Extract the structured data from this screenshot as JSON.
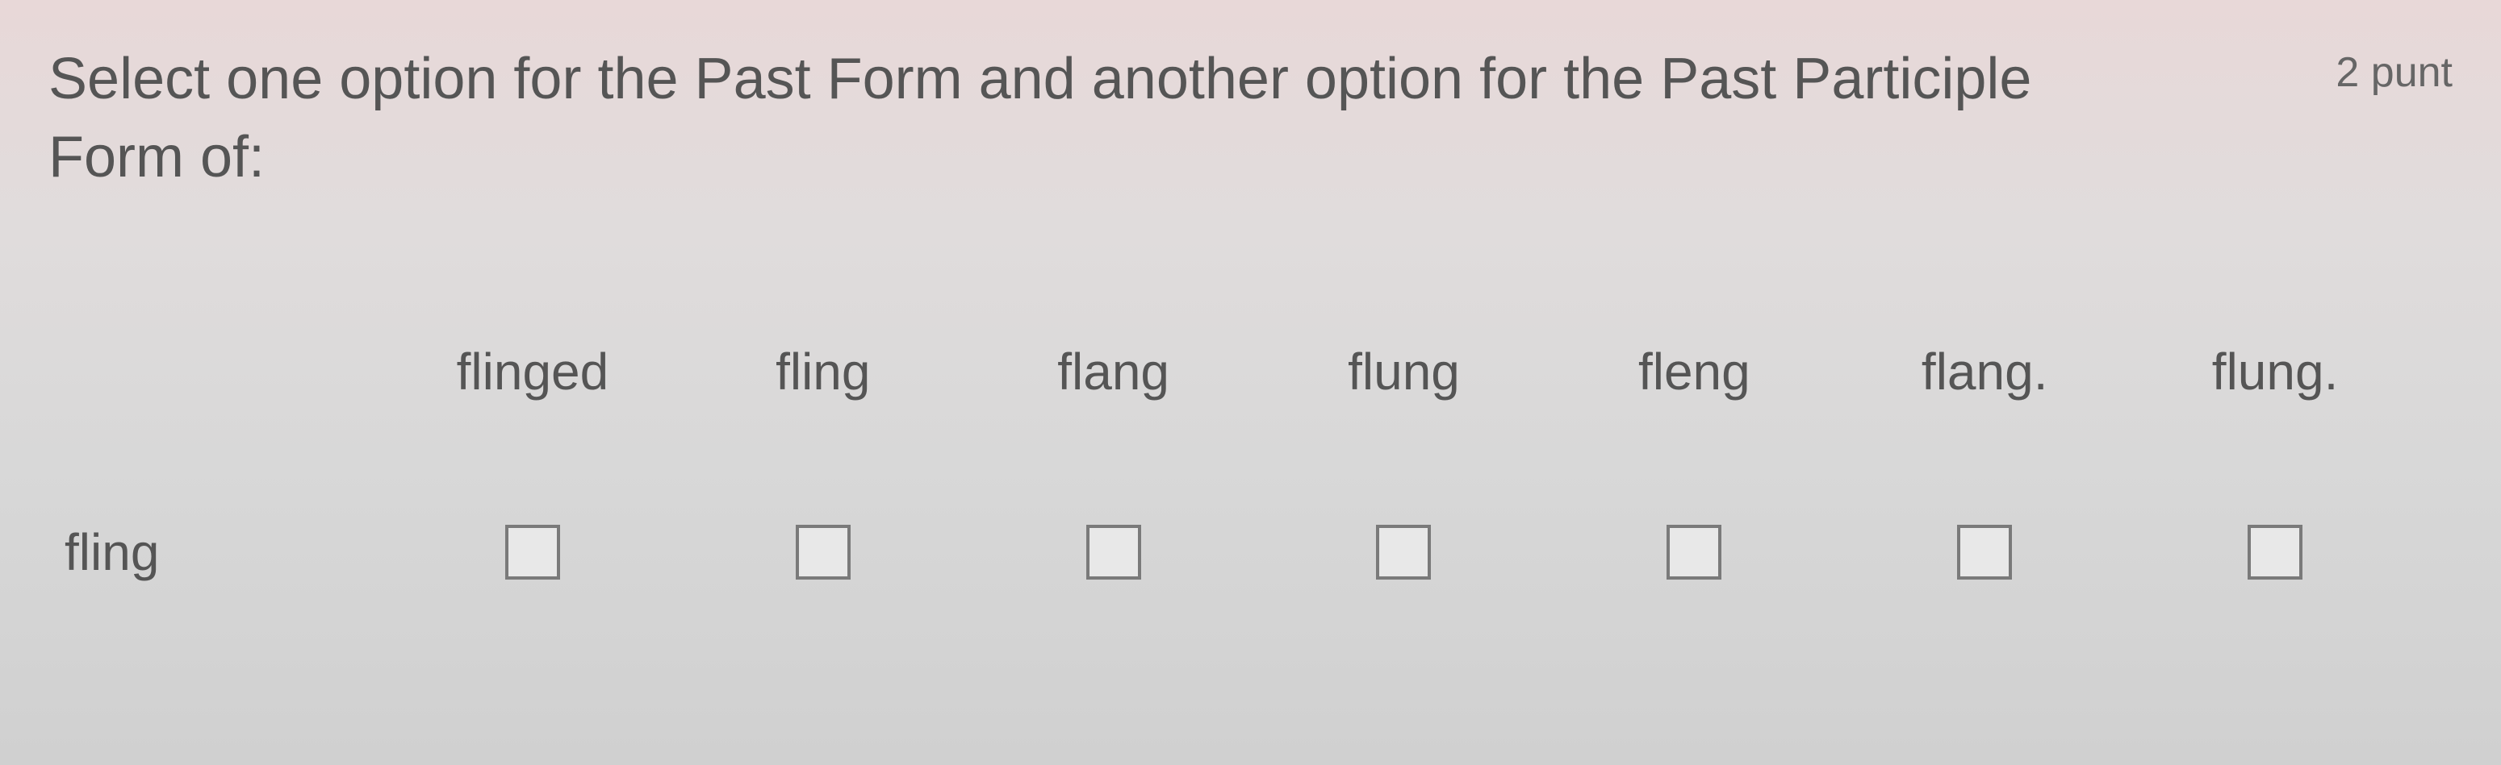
{
  "question": {
    "prompt": "Select one option for the Past Form and another option for the Past Participle Form of:",
    "points_label": "2 punt"
  },
  "columns": [
    "flinged",
    "fling",
    "flang",
    "flung",
    "fleng",
    "flang.",
    "flung."
  ],
  "row": {
    "label": "fling"
  }
}
